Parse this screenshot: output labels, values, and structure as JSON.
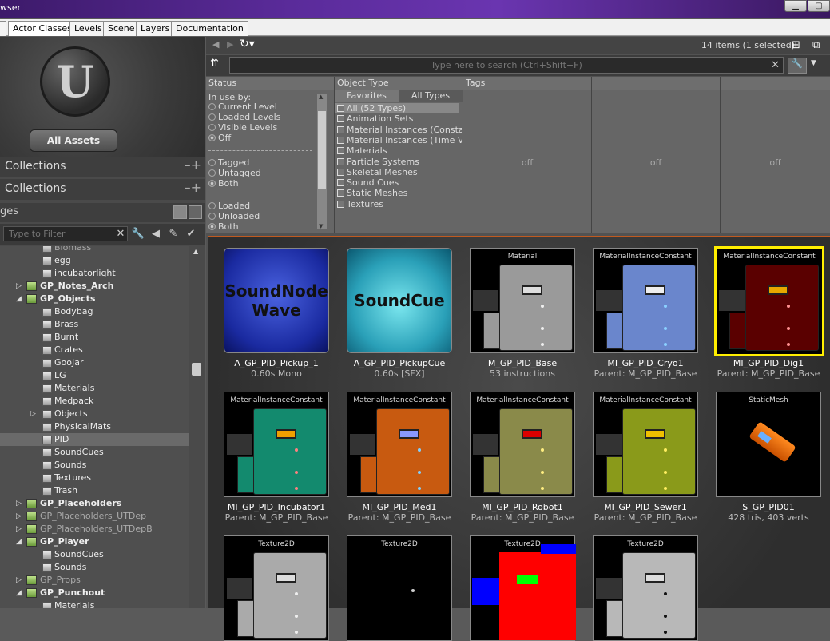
{
  "window": {
    "title": "wser"
  },
  "tabs": [
    "Actor Classes",
    "Levels",
    "Scene",
    "Layers",
    "Documentation"
  ],
  "left": {
    "all_assets": "All Assets",
    "collections1": "Collections",
    "collections2": "Collections",
    "packages_label": "ges",
    "filter_placeholder": "Type to Filter",
    "tree": [
      {
        "label": "Biomass",
        "indent": 68,
        "kind": "folder",
        "style": "dim"
      },
      {
        "label": "egg",
        "indent": 68,
        "kind": "folder"
      },
      {
        "label": "incubatorlight",
        "indent": 68,
        "kind": "folder"
      },
      {
        "label": "GP_Notes_Arch",
        "indent": 50,
        "kind": "pkg",
        "arrow": "▷",
        "style": "bold"
      },
      {
        "label": "GP_Objects",
        "indent": 50,
        "kind": "pkg",
        "arrow": "◢",
        "style": "bold"
      },
      {
        "label": "Bodybag",
        "indent": 68,
        "kind": "folder"
      },
      {
        "label": "Brass",
        "indent": 68,
        "kind": "folder"
      },
      {
        "label": "Burnt",
        "indent": 68,
        "kind": "folder"
      },
      {
        "label": "Crates",
        "indent": 68,
        "kind": "folder"
      },
      {
        "label": "GooJar",
        "indent": 68,
        "kind": "folder"
      },
      {
        "label": "LG",
        "indent": 68,
        "kind": "folder"
      },
      {
        "label": "Materials",
        "indent": 68,
        "kind": "folder"
      },
      {
        "label": "Medpack",
        "indent": 68,
        "kind": "folder"
      },
      {
        "label": "Objects",
        "indent": 68,
        "kind": "folder",
        "arrow": "▷"
      },
      {
        "label": "PhysicalMats",
        "indent": 68,
        "kind": "folder"
      },
      {
        "label": "PID",
        "indent": 68,
        "kind": "folder",
        "style": "sel"
      },
      {
        "label": "SoundCues",
        "indent": 68,
        "kind": "folder"
      },
      {
        "label": "Sounds",
        "indent": 68,
        "kind": "folder"
      },
      {
        "label": "Textures",
        "indent": 68,
        "kind": "folder"
      },
      {
        "label": "Trash",
        "indent": 68,
        "kind": "folder"
      },
      {
        "label": "GP_Placeholders",
        "indent": 50,
        "kind": "pkg",
        "arrow": "▷",
        "style": "bold"
      },
      {
        "label": "GP_Placeholders_UTDep",
        "indent": 50,
        "kind": "pkg",
        "arrow": "▷",
        "style": "dim"
      },
      {
        "label": "GP_Placeholders_UTDepB",
        "indent": 50,
        "kind": "pkg",
        "arrow": "▷",
        "style": "dim"
      },
      {
        "label": "GP_Player",
        "indent": 50,
        "kind": "pkg",
        "arrow": "◢",
        "style": "bold"
      },
      {
        "label": "SoundCues",
        "indent": 68,
        "kind": "folder"
      },
      {
        "label": "Sounds",
        "indent": 68,
        "kind": "folder"
      },
      {
        "label": "GP_Props",
        "indent": 50,
        "kind": "pkg",
        "arrow": "▷",
        "style": "dim"
      },
      {
        "label": "GP_Punchout",
        "indent": 50,
        "kind": "pkg",
        "arrow": "◢",
        "style": "bold"
      },
      {
        "label": "Materials",
        "indent": 68,
        "kind": "folder"
      }
    ]
  },
  "toolbar": {
    "count": "14 items (1 selected)",
    "search_placeholder": "Type here to search  (Ctrl+Shift+F)"
  },
  "filters": {
    "status_header": "Status",
    "in_use_by": "In use by:",
    "status_opts1": [
      "Current Level",
      "Loaded Levels",
      "Visible Levels",
      "Off"
    ],
    "status_opts2": [
      "Tagged",
      "Untagged",
      "Both"
    ],
    "status_opts3": [
      "Loaded",
      "Unloaded",
      "Both"
    ],
    "objtype_header": "Object Type",
    "fav_tab": "Favorites",
    "alltypes_tab": "All Types",
    "types": [
      "All (52 Types)",
      "Animation Sets",
      "Material Instances (Constant)",
      "Material Instances (Time Vary",
      "Materials",
      "Particle Systems",
      "Skeletal Meshes",
      "Sound Cues",
      "Static Meshes",
      "Textures"
    ],
    "tags_header": "Tags",
    "off": "off"
  },
  "assets": [
    {
      "name": "A_GP_PID_Pickup_1",
      "sub": "0.60s Mono",
      "thumb_text": "SoundNode Wave",
      "kind": "soundwave"
    },
    {
      "name": "A_GP_PID_PickupCue",
      "sub": "0.60s [SFX]",
      "thumb_text": "SoundCue",
      "kind": "soundcue"
    },
    {
      "name": "M_GP_PID_Base",
      "sub": "53 instructions",
      "type": "Material",
      "kind": "mat",
      "color": "#9a9a9a",
      "slot": "#dddddd",
      "dotc": "#eeeeee"
    },
    {
      "name": "MI_GP_PID_Cryo1",
      "sub": "Parent: M_GP_PID_Base",
      "type": "MaterialInstanceConstant",
      "kind": "mat",
      "color": "#6a86cc",
      "slot": "#eeeeee",
      "dotc": "#8ad0ff"
    },
    {
      "name": "MI_GP_PID_Dig1",
      "sub": "Parent: M_GP_PID_Base",
      "type": "MaterialInstanceConstant",
      "kind": "mat",
      "color": "#5a0000",
      "slot": "#e8a800",
      "dotc": "#ff9090",
      "selected": true
    },
    {
      "name": "MI_GP_PID_Incubator1",
      "sub": "Parent: M_GP_PID_Base",
      "type": "MaterialInstanceConstant",
      "kind": "mat",
      "color": "#138a6e",
      "slot": "#f0a000",
      "dotc": "#ff8080"
    },
    {
      "name": "MI_GP_PID_Med1",
      "sub": "Parent: M_GP_PID_Base",
      "type": "MaterialInstanceConstant",
      "kind": "mat",
      "color": "#c85a10",
      "slot": "#8899ff",
      "dotc": "#80d0ff"
    },
    {
      "name": "MI_GP_PID_Robot1",
      "sub": "Parent: M_GP_PID_Base",
      "type": "MaterialInstanceConstant",
      "kind": "mat",
      "color": "#8a8a4a",
      "slot": "#dd0000",
      "dotc": "#ffee80"
    },
    {
      "name": "MI_GP_PID_Sewer1",
      "sub": "Parent: M_GP_PID_Base",
      "type": "MaterialInstanceConstant",
      "kind": "mat",
      "color": "#8a9a1a",
      "slot": "#f0c000",
      "dotc": "#ffee60"
    },
    {
      "name": "S_GP_PID01",
      "sub": "428 tris, 403 verts",
      "type": "StaticMesh",
      "kind": "mesh"
    },
    {
      "name": "",
      "sub": "",
      "type": "Texture2D",
      "kind": "mat",
      "color": "#aaaaaa",
      "slot": "#dddddd",
      "dotc": "#eeeeee"
    },
    {
      "name": "",
      "sub": "",
      "type": "Texture2D",
      "kind": "black"
    },
    {
      "name": "",
      "sub": "",
      "type": "Texture2D",
      "kind": "red"
    },
    {
      "name": "",
      "sub": "",
      "type": "Texture2D",
      "kind": "mat",
      "color": "#b8b8b8",
      "slot": "#dddddd",
      "dotc": "#111111"
    }
  ]
}
